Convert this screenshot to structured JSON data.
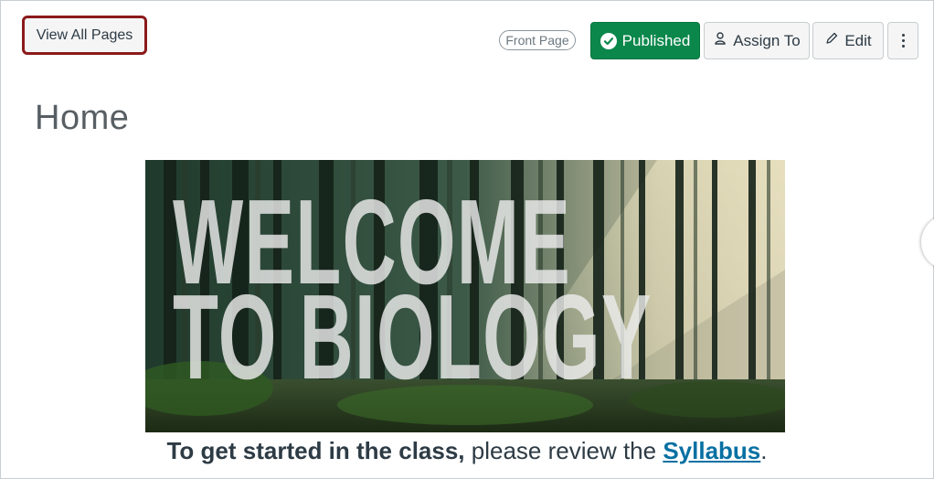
{
  "toolbar": {
    "view_all_label": "View All Pages",
    "front_page_badge": "Front Page",
    "published_label": "Published",
    "assign_label": "Assign To",
    "edit_label": "Edit"
  },
  "page": {
    "title": "Home"
  },
  "banner": {
    "line1": "WELCOME",
    "line2": "TO BIOLOGY"
  },
  "intro": {
    "bold": "To get started in the class,",
    "middle": " please review the ",
    "link": "Syllabus",
    "end": "."
  },
  "colors": {
    "published": "#0b874b",
    "highlight_border": "#8b1a1a",
    "link": "#0770a3"
  }
}
